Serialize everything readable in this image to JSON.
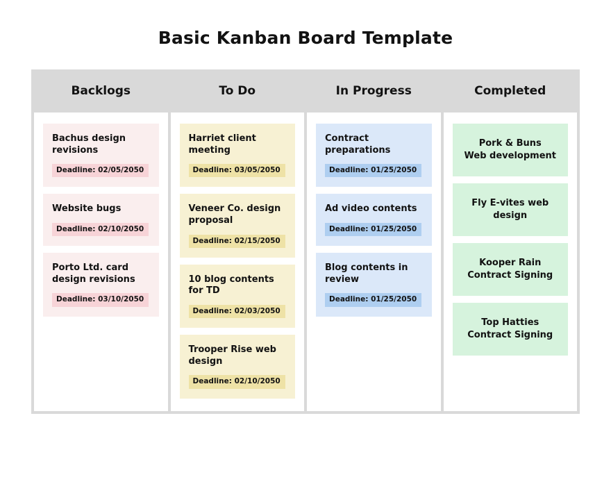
{
  "page": {
    "title": "Basic Kanban Board Template"
  },
  "board": {
    "columns": [
      {
        "id": "backlogs",
        "header": "Backlogs",
        "header_color": "#f9d5d8",
        "card_color": "#faeeee",
        "badge_color": "#f7d3d7",
        "cards": [
          {
            "title": "Bachus design revisions",
            "deadline": "Deadline: 02/05/2050"
          },
          {
            "title": "Website bugs",
            "deadline": "Deadline: 02/10/2050"
          },
          {
            "title": "Porto Ltd. card design revisions",
            "deadline": "Deadline: 03/10/2050"
          }
        ]
      },
      {
        "id": "todo",
        "header": "To Do",
        "header_color": "#f7f3d6",
        "card_color": "#f7f1d3",
        "badge_color": "#eee2a6",
        "cards": [
          {
            "title": "Harriet client meeting",
            "deadline": "Deadline: 03/05/2050"
          },
          {
            "title": "Veneer Co. design proposal",
            "deadline": "Deadline: 02/15/2050"
          },
          {
            "title": "10 blog contents for TD",
            "deadline": "Deadline: 02/03/2050"
          },
          {
            "title": "Trooper Rise web design",
            "deadline": "Deadline: 02/10/2050"
          }
        ]
      },
      {
        "id": "progress",
        "header": "In Progress",
        "header_color": "#dbe7f7",
        "card_color": "#dbe8f9",
        "badge_color": "#aecef0",
        "cards": [
          {
            "title": "Contract preparations",
            "deadline": "Deadline: 01/25/2050"
          },
          {
            "title": "Ad video contents",
            "deadline": "Deadline: 01/25/2050"
          },
          {
            "title": "Blog contents in review",
            "deadline": "Deadline: 01/25/2050"
          }
        ]
      },
      {
        "id": "completed",
        "header": "Completed",
        "header_color": "#d9f3dd",
        "card_color": "#d6f3dd",
        "badge_color": null,
        "cards": [
          {
            "title": "Pork & Buns\nWeb development",
            "deadline": null
          },
          {
            "title": "Fly E-vites web design",
            "deadline": null
          },
          {
            "title": "Kooper Rain Contract Signing",
            "deadline": null
          },
          {
            "title": "Top Hatties Contract Signing",
            "deadline": null
          }
        ]
      }
    ]
  }
}
